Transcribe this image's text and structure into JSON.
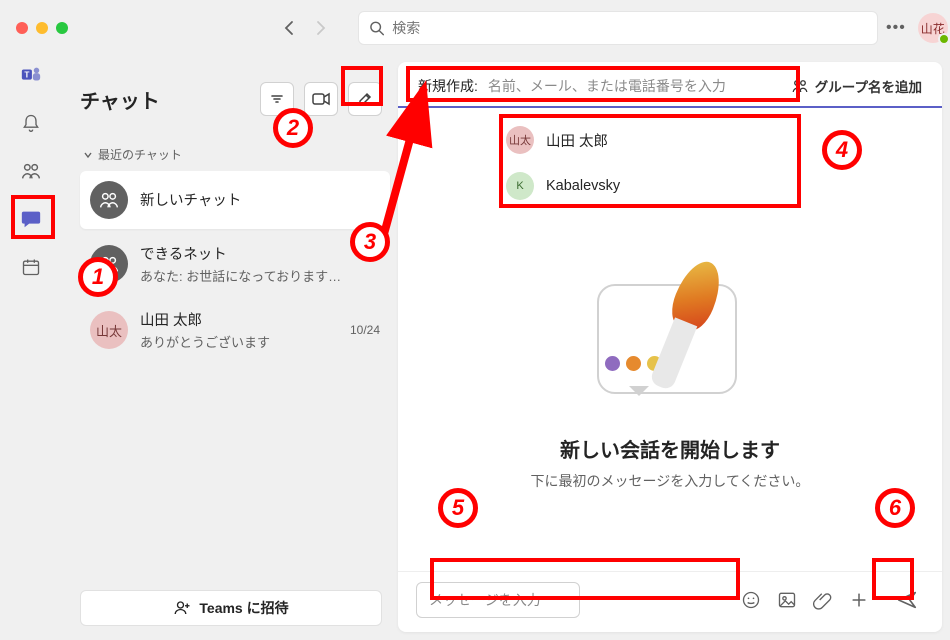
{
  "header": {
    "search_placeholder": "検索",
    "user_avatar_text": "山花"
  },
  "chatcol": {
    "title": "チャット",
    "section_recent": "最近のチャット",
    "invite_label": "Teams に招待"
  },
  "chats": [
    {
      "name": "新しいチャット",
      "sub": "",
      "ts": "",
      "avatar_text": "",
      "active": true
    },
    {
      "name": "できるネット",
      "sub": "あなた: お世話になっております…",
      "ts": "",
      "avatar_text": ""
    },
    {
      "name": "山田 太郎",
      "sub": "ありがとうございます",
      "ts": "10/24",
      "avatar_text": "山太"
    }
  ],
  "compose_to": {
    "label": "新規作成:",
    "placeholder": "名前、メール、または電話番号を入力",
    "add_group": "グループ名を追加"
  },
  "suggestions": [
    {
      "avatar_text": "山太",
      "name": "山田 太郎",
      "color_bg": "#eac0c0",
      "color_fg": "#773838"
    },
    {
      "avatar_text": "K",
      "name": "Kabalevsky",
      "color_bg": "#cfe8c9",
      "color_fg": "#3a6b2f"
    }
  ],
  "conversation": {
    "heading": "新しい会話を開始します",
    "subtext": "下に最初のメッセージを入力してください。"
  },
  "composer": {
    "placeholder": "メッセージを入力"
  },
  "annotations": {
    "n1": "1",
    "n2": "2",
    "n3": "3",
    "n4": "4",
    "n5": "5",
    "n6": "6"
  }
}
